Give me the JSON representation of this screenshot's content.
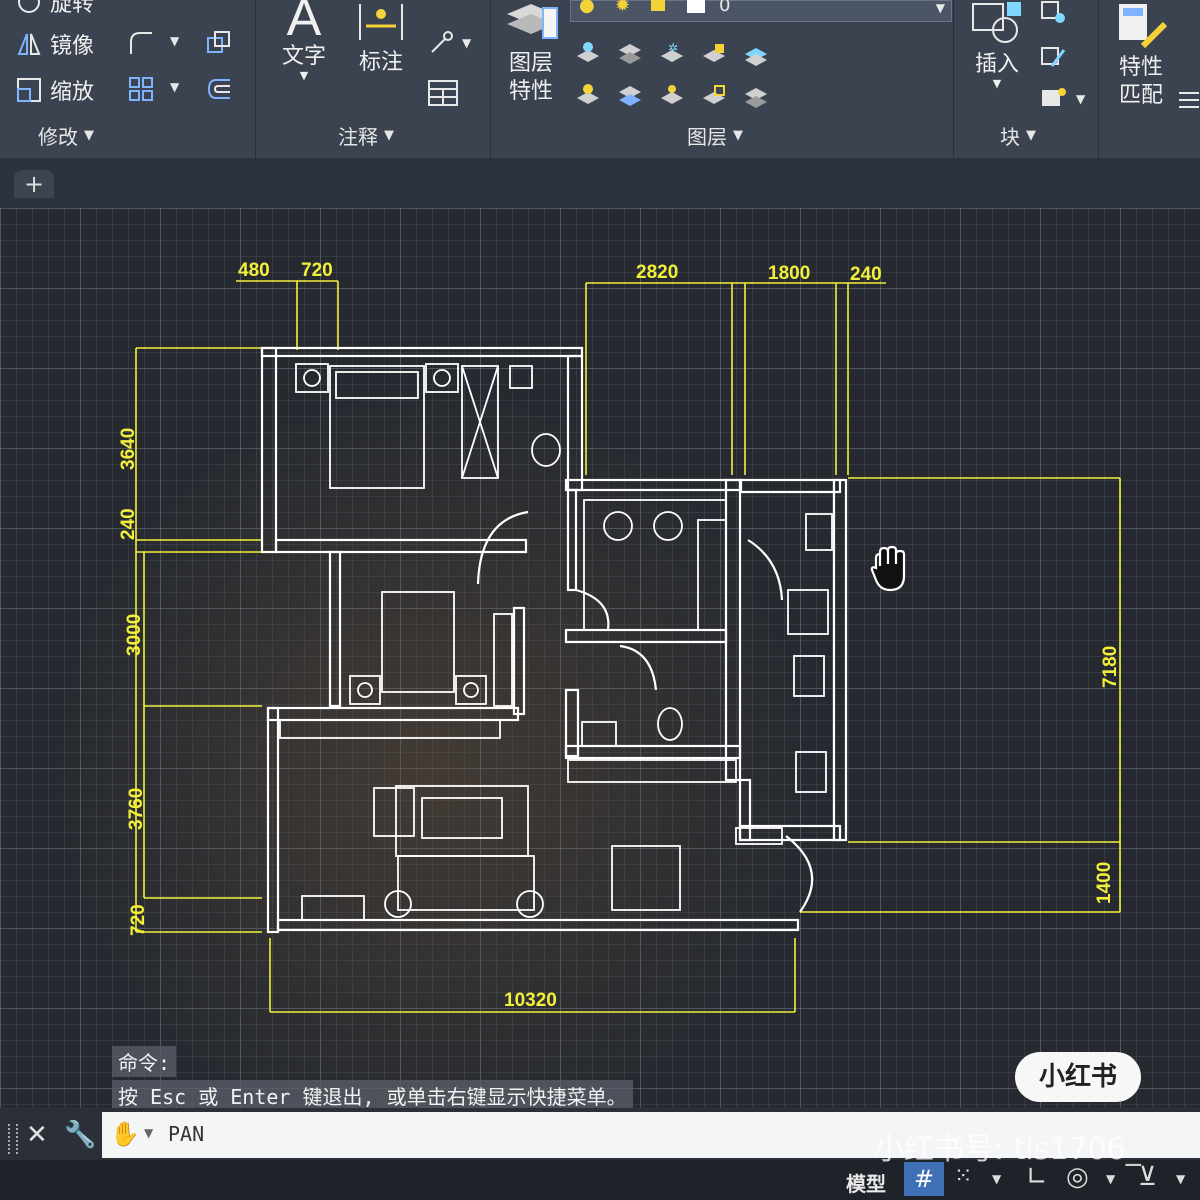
{
  "ribbon": {
    "modify": {
      "tools": [
        "旋转",
        "镜像",
        "缩放"
      ],
      "panel_label": "修改"
    },
    "annotation": {
      "text_label": "文字",
      "dimension_label": "标注",
      "panel_label": "注释"
    },
    "layers": {
      "properties_label": "图层\n特性",
      "current_layer": "0",
      "panel_label": "图层"
    },
    "block": {
      "insert_label": "插入",
      "panel_label": "块"
    },
    "properties": {
      "match_label": "特性\n匹配"
    }
  },
  "tabs": {
    "add_label": "+"
  },
  "drawing": {
    "dims_top": [
      "480",
      "720",
      "2820",
      "1800",
      "240"
    ],
    "dims_left": [
      "3640",
      "240",
      "3000",
      "3760",
      "720"
    ],
    "dims_right": [
      "7180",
      "1400"
    ],
    "dims_bottom": [
      "10320"
    ],
    "line_color": "#f3f03a",
    "wall_color": "#ffffff",
    "cursor_icon": "pan-hand-icon"
  },
  "command": {
    "history_label": "命令:",
    "history_prompt": "按 Esc 或 Enter 键退出, 或单击右键显示快捷菜单。",
    "current": "PAN"
  },
  "status": {
    "model_label": "模型"
  },
  "watermark": {
    "badge": "小红书",
    "handle": "小红书号: tis1706_"
  }
}
